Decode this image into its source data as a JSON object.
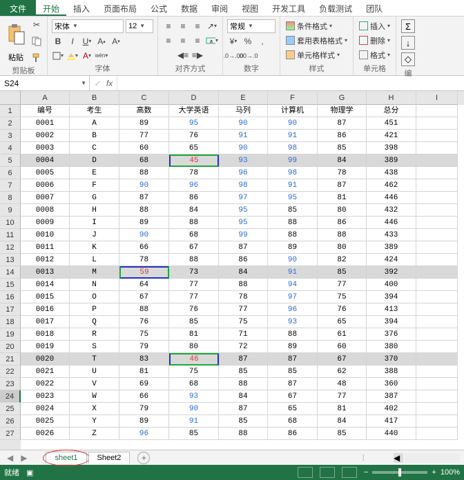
{
  "menu": {
    "file": "文件",
    "tabs": [
      "开始",
      "插入",
      "页面布局",
      "公式",
      "数据",
      "审阅",
      "视图",
      "开发工具",
      "负载测试",
      "团队"
    ],
    "active": 0
  },
  "ribbon": {
    "clipboard": {
      "paste": "粘贴",
      "label": "剪贴板"
    },
    "font": {
      "name": "宋体",
      "size": "12",
      "label": "字体"
    },
    "align": {
      "label": "对齐方式"
    },
    "number": {
      "format": "常规",
      "label": "数字"
    },
    "styles": {
      "cond": "条件格式",
      "table": "套用表格格式",
      "cell": "单元格样式",
      "label": "样式"
    },
    "cells": {
      "insert": "插入",
      "delete": "删除",
      "format": "格式",
      "label": "单元格"
    },
    "editing": {
      "label": "编"
    }
  },
  "namebox": "S24",
  "columns": [
    "A",
    "B",
    "C",
    "D",
    "E",
    "F",
    "G",
    "H",
    "I"
  ],
  "colWidths": [
    "wA",
    "wB",
    "wC",
    "wD",
    "wE",
    "wF",
    "wG",
    "wH",
    "wI"
  ],
  "headers": [
    "编号",
    "考生",
    "高数",
    "大学英语",
    "马列",
    "计算机",
    "物理学",
    "总分"
  ],
  "rows": [
    {
      "n": 1,
      "header": true
    },
    {
      "n": 2,
      "d": [
        "0001",
        "A",
        "89",
        "95",
        "90",
        "90",
        "87",
        "451"
      ],
      "blue": [
        3,
        4,
        5
      ]
    },
    {
      "n": 3,
      "d": [
        "0002",
        "B",
        "77",
        "76",
        "91",
        "91",
        "86",
        "421"
      ],
      "blue": [
        4,
        5
      ]
    },
    {
      "n": 4,
      "d": [
        "0003",
        "C",
        "60",
        "65",
        "90",
        "98",
        "85",
        "398"
      ],
      "blue": [
        4,
        5
      ]
    },
    {
      "n": 5,
      "d": [
        "0004",
        "D",
        "68",
        "45",
        "93",
        "99",
        "84",
        "389"
      ],
      "blue": [
        4,
        5
      ],
      "hl": true,
      "box": {
        "col": 3,
        "type": "red"
      }
    },
    {
      "n": 6,
      "d": [
        "0005",
        "E",
        "88",
        "78",
        "96",
        "98",
        "78",
        "438"
      ],
      "blue": [
        4,
        5
      ]
    },
    {
      "n": 7,
      "d": [
        "0006",
        "F",
        "90",
        "96",
        "98",
        "91",
        "87",
        "462"
      ],
      "blue": [
        2,
        3,
        4,
        5
      ]
    },
    {
      "n": 8,
      "d": [
        "0007",
        "G",
        "87",
        "86",
        "97",
        "95",
        "81",
        "446"
      ],
      "blue": [
        4,
        5
      ]
    },
    {
      "n": 9,
      "d": [
        "0008",
        "H",
        "88",
        "84",
        "95",
        "85",
        "80",
        "432"
      ],
      "blue": [
        4
      ]
    },
    {
      "n": 10,
      "d": [
        "0009",
        "I",
        "89",
        "88",
        "95",
        "88",
        "86",
        "446"
      ],
      "blue": [
        4
      ]
    },
    {
      "n": 11,
      "d": [
        "0010",
        "J",
        "90",
        "68",
        "99",
        "88",
        "88",
        "433"
      ],
      "blue": [
        2,
        4
      ]
    },
    {
      "n": 12,
      "d": [
        "0011",
        "K",
        "66",
        "67",
        "87",
        "89",
        "80",
        "389"
      ]
    },
    {
      "n": 13,
      "d": [
        "0012",
        "L",
        "78",
        "88",
        "86",
        "90",
        "82",
        "424"
      ],
      "blue": [
        5
      ]
    },
    {
      "n": 14,
      "d": [
        "0013",
        "M",
        "59",
        "73",
        "84",
        "91",
        "85",
        "392"
      ],
      "blue": [
        5
      ],
      "hl": true,
      "box": {
        "col": 2,
        "type": "green"
      }
    },
    {
      "n": 15,
      "d": [
        "0014",
        "N",
        "64",
        "77",
        "88",
        "94",
        "77",
        "400"
      ],
      "blue": [
        5
      ]
    },
    {
      "n": 16,
      "d": [
        "0015",
        "O",
        "67",
        "77",
        "78",
        "97",
        "75",
        "394"
      ],
      "blue": [
        5
      ]
    },
    {
      "n": 17,
      "d": [
        "0016",
        "P",
        "88",
        "76",
        "77",
        "96",
        "76",
        "413"
      ],
      "blue": [
        5
      ]
    },
    {
      "n": 18,
      "d": [
        "0017",
        "Q",
        "76",
        "85",
        "75",
        "93",
        "65",
        "394"
      ],
      "blue": [
        5
      ]
    },
    {
      "n": 19,
      "d": [
        "0018",
        "R",
        "75",
        "81",
        "71",
        "88",
        "61",
        "376"
      ]
    },
    {
      "n": 20,
      "d": [
        "0019",
        "S",
        "79",
        "80",
        "72",
        "89",
        "60",
        "380"
      ]
    },
    {
      "n": 21,
      "d": [
        "0020",
        "T",
        "83",
        "46",
        "87",
        "87",
        "67",
        "370"
      ],
      "hl": true,
      "box": {
        "col": 3,
        "type": "red"
      }
    },
    {
      "n": 22,
      "d": [
        "0021",
        "U",
        "81",
        "75",
        "85",
        "85",
        "62",
        "388"
      ]
    },
    {
      "n": 23,
      "d": [
        "0022",
        "V",
        "69",
        "68",
        "88",
        "87",
        "48",
        "360"
      ]
    },
    {
      "n": 24,
      "d": [
        "0023",
        "W",
        "66",
        "93",
        "84",
        "67",
        "77",
        "387"
      ],
      "blue": [
        3
      ],
      "sel": true
    },
    {
      "n": 25,
      "d": [
        "0024",
        "X",
        "79",
        "90",
        "87",
        "65",
        "81",
        "402"
      ],
      "blue": [
        3
      ]
    },
    {
      "n": 26,
      "d": [
        "0025",
        "Y",
        "89",
        "91",
        "85",
        "68",
        "84",
        "417"
      ],
      "blue": [
        3
      ]
    },
    {
      "n": 27,
      "d": [
        "0026",
        "Z",
        "96",
        "85",
        "88",
        "86",
        "85",
        "440"
      ],
      "blue": [
        2
      ]
    }
  ],
  "sheets": {
    "tabs": [
      "sheet1",
      "Sheet2"
    ],
    "active": 0
  },
  "status": {
    "ready": "就绪",
    "zoom": "100%"
  }
}
